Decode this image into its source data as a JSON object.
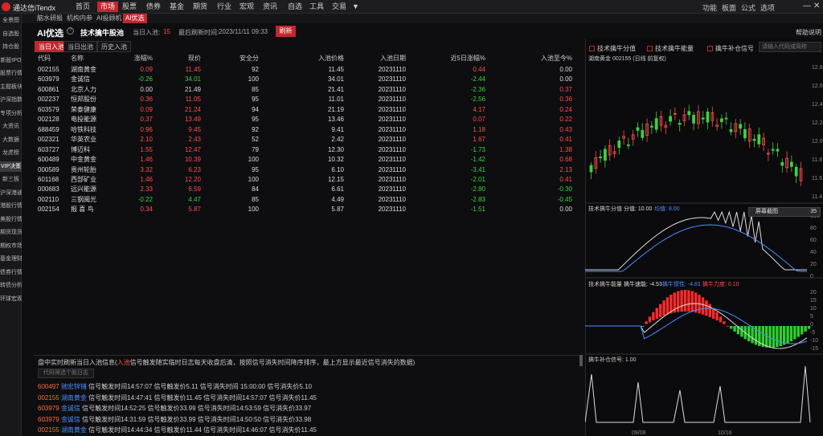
{
  "app": {
    "title": "通达信iTendx"
  },
  "menu": [
    "首页",
    "市场",
    "股票",
    "债券",
    "基金",
    "期货",
    "行业",
    "宏观",
    "资讯",
    "自选",
    "工具",
    "交易"
  ],
  "menu_active": 1,
  "right_menu": [
    "功能",
    "板面",
    "公式",
    "选项"
  ],
  "subtabs": [
    "脑水研报",
    "机构内参",
    "AI投顾机",
    "AI优选"
  ],
  "subtab_active": 3,
  "leftnav": [
    "全景图",
    "自选股",
    "持仓股",
    "新股IPO",
    "股票行情",
    "主题板块",
    "沪深指数",
    "专项分析",
    "大资讯",
    "大数据",
    "龙虎榜",
    "VIP决策",
    "新三板",
    "沪深港通",
    "港股行情",
    "美股行情",
    "期货现货",
    "期权市场",
    "基金理财",
    "债券行情",
    "转债分析",
    "环球宏观"
  ],
  "leftnav_active": 11,
  "header": {
    "title": "AI优选",
    "subtitle": "技术擒牛股池",
    "today_label": "当日入池:",
    "today_count": "15",
    "refresh_label": "最后刷新时间:",
    "refresh_time": "2023/11/11 09:33",
    "refresh_btn": "刷新",
    "help": "帮助说明"
  },
  "panel_tabs": [
    "当日入池",
    "当日出池",
    "历史入池"
  ],
  "columns": [
    "代码",
    "名称",
    "涨幅%",
    "现价",
    "安全分",
    "入池价格",
    "入池日期",
    "近5日涨幅%",
    "入池至今%"
  ],
  "rows": [
    {
      "code": "002155",
      "name": "湖南黄金",
      "chg": "0.09",
      "price": "11.45",
      "score": "92",
      "inprice": "11.45",
      "date": "20231110",
      "d5": "0.44",
      "since": "0.00",
      "up": 1,
      "u5": 1,
      "us": 0
    },
    {
      "code": "603979",
      "name": "金诚信",
      "chg": "-0.26",
      "price": "34.01",
      "score": "100",
      "inprice": "34.01",
      "date": "20231110",
      "d5": "-2.44",
      "since": "0.00",
      "up": -1,
      "u5": -1,
      "us": 0
    },
    {
      "code": "600861",
      "name": "北京人力",
      "chg": "0.00",
      "price": "21.49",
      "score": "85",
      "inprice": "21.41",
      "date": "20231110",
      "d5": "-2.36",
      "since": "0.37",
      "up": 0,
      "u5": -1,
      "us": 1
    },
    {
      "code": "002237",
      "name": "恒邦股份",
      "chg": "0.36",
      "price": "11.05",
      "score": "95",
      "inprice": "11.01",
      "date": "20231110",
      "d5": "-2.56",
      "since": "0.36",
      "up": 1,
      "u5": -1,
      "us": 1
    },
    {
      "code": "603579",
      "name": "荣泰健康",
      "chg": "0.09",
      "price": "21.24",
      "score": "94",
      "inprice": "21.19",
      "date": "20231110",
      "d5": "4.17",
      "since": "0.24",
      "up": 1,
      "u5": 1,
      "us": 1
    },
    {
      "code": "002128",
      "name": "电投能源",
      "chg": "0.37",
      "price": "13.49",
      "score": "95",
      "inprice": "13.46",
      "date": "20231110",
      "d5": "0.07",
      "since": "0.22",
      "up": 1,
      "u5": 1,
      "us": 1
    },
    {
      "code": "688459",
      "name": "哈铁科技",
      "chg": "0.96",
      "price": "9.45",
      "score": "92",
      "inprice": "9.41",
      "date": "20231110",
      "d5": "1.18",
      "since": "0.43",
      "up": 1,
      "u5": 1,
      "us": 1
    },
    {
      "code": "002321",
      "name": "华英农业",
      "chg": "2.10",
      "price": "2.43",
      "score": "52",
      "inprice": "2.42",
      "date": "20231110",
      "d5": "1.67",
      "since": "0.41",
      "up": 1,
      "u5": 1,
      "us": 1
    },
    {
      "code": "603727",
      "name": "博迈科",
      "chg": "1.55",
      "price": "12.47",
      "score": "79",
      "inprice": "12.30",
      "date": "20231110",
      "d5": "-1.73",
      "since": "1.38",
      "up": 1,
      "u5": -1,
      "us": 1
    },
    {
      "code": "600489",
      "name": "中金黄金",
      "chg": "1.46",
      "price": "10.39",
      "score": "100",
      "inprice": "10.32",
      "date": "20231110",
      "d5": "-1.42",
      "since": "0.68",
      "up": 1,
      "u5": -1,
      "us": 1
    },
    {
      "code": "000589",
      "name": "贵州轮胎",
      "chg": "3.32",
      "price": "6.23",
      "score": "95",
      "inprice": "6.10",
      "date": "20231110",
      "d5": "-3.41",
      "since": "2.13",
      "up": 1,
      "u5": -1,
      "us": 1
    },
    {
      "code": "601168",
      "name": "西部矿业",
      "chg": "1.46",
      "price": "12.20",
      "score": "100",
      "inprice": "12.15",
      "date": "20231110",
      "d5": "-2.01",
      "since": "0.41",
      "up": 1,
      "u5": -1,
      "us": 1
    },
    {
      "code": "000683",
      "name": "远兴能源",
      "chg": "2.33",
      "price": "6.59",
      "score": "84",
      "inprice": "6.61",
      "date": "20231110",
      "d5": "-2.80",
      "since": "-0.30",
      "up": 1,
      "u5": -1,
      "us": -1
    },
    {
      "code": "002110",
      "name": "三钢闽光",
      "chg": "-0.22",
      "price": "4.47",
      "score": "85",
      "inprice": "4.49",
      "date": "20231110",
      "d5": "-2.83",
      "since": "-0.45",
      "up": -1,
      "u5": -1,
      "us": -1
    },
    {
      "code": "002154",
      "name": "报 喜 鸟",
      "chg": "0.34",
      "price": "5.87",
      "score": "100",
      "inprice": "5.87",
      "date": "20231110",
      "d5": "-1.51",
      "since": "0.00",
      "up": 1,
      "u5": -1,
      "us": 0
    }
  ],
  "checks": [
    "技术擒牛分值",
    "技术擒牛能量",
    "擒牛补仓信号"
  ],
  "code_input_placeholder": "请输入代码或简称",
  "kline": {
    "title": "湖南黄金 002155 (日线 前复权)",
    "ticks": [
      "12.8",
      "12.6",
      "12.4",
      "12.2",
      "12.0",
      "11.8",
      "11.6",
      "11.4"
    ],
    "menu_label": "屏幕截图",
    "menu_value": "35"
  },
  "sub1": {
    "label": "技术擒牛分值",
    "val_label": "分值: 10.00",
    "avg_label": "均值: 8.00",
    "ticks": [
      "100",
      "80",
      "60",
      "40",
      "20",
      "0"
    ]
  },
  "sub2": {
    "label": "技术擒牛能量",
    "a": "擒牛速能: -4.53",
    "b": "擒牛惯性: -4.81",
    "c": "擒牛力度: 0.10",
    "ticks": [
      "20",
      "15",
      "10",
      "5",
      "0",
      "-5",
      "-10",
      "-15"
    ]
  },
  "sub3": {
    "label": "擒牛补仓信号: 1.00",
    "dates": [
      "09/08",
      "10/16"
    ]
  },
  "bottom": {
    "desc_pre": "盘中实时刷新当日入池信息(",
    "desc_red": "入池",
    "desc_post": "信号触发随实临时日志每天收盘后清，按照信号消失时间降序排序，最上方显示最近信号消失的数据)",
    "filter_btn": "代码筛选个股日志"
  },
  "logs": [
    {
      "code": "600497",
      "name": "驰宏锌锗",
      "text": "信号触发时间14:57:07 信号触发价5.11 信号消失时间 15:00:00 信号消失价5.10"
    },
    {
      "code": "002155",
      "name": "湖南黄金",
      "text": "信号触发时间14:47:41 信号触发价11.45 信号消失时间14:57:07 信号消失价11.45"
    },
    {
      "code": "603979",
      "name": "金诚信",
      "text": "信号触发时间14:52:25 信号触发价33.99 信号消失时间14:53:59 信号消失价33.97"
    },
    {
      "code": "603979",
      "name": "金诚信",
      "text": "信号触发时间14:31:59 信号触发价33.99 信号消失时间14:50:50 信号消失价33.98"
    },
    {
      "code": "002155",
      "name": "湖南黄金",
      "text": "信号触发时间14:44:34 信号触发价11.44 信号消失时间14:46:07 信号消失价11.45"
    }
  ],
  "colors": {
    "accent": "#c0282d",
    "up": "#ff4b4b",
    "down": "#3fcf3f"
  }
}
